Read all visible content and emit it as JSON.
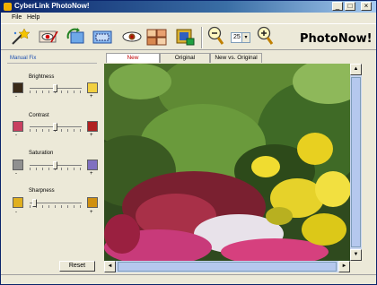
{
  "window": {
    "title": "CyberLink PhotoNow!",
    "controls": [
      "_",
      "□",
      "×"
    ]
  },
  "menu": [
    "File",
    "Help"
  ],
  "toolbar": {
    "zoom_value": "25",
    "zoom_drop": "▾",
    "brand": "PhotoNow!",
    "icons": [
      "magic-wand-icon",
      "red-eye-icon",
      "rotate-icon",
      "crop-icon",
      "eye-icon",
      "faces-icon",
      "frame-icon",
      "zoom-out-icon",
      "zoom-in-icon"
    ]
  },
  "panel": {
    "heading": "Manual Fix",
    "adjustments": [
      {
        "label": "Brightness",
        "value": 0.5
      },
      {
        "label": "Contrast",
        "value": 0.5
      },
      {
        "label": "Saturation",
        "value": 0.5
      },
      {
        "label": "Sharpness",
        "value": 0.1
      }
    ],
    "minus": "-",
    "plus": "+",
    "reset": "Reset"
  },
  "tabs": [
    {
      "label": "New",
      "active": true
    },
    {
      "label": "Original",
      "active": false
    },
    {
      "label": "New vs. Original",
      "active": false
    }
  ],
  "scroll": {
    "up": "▲",
    "down": "▼",
    "left": "◄",
    "right": "►"
  }
}
